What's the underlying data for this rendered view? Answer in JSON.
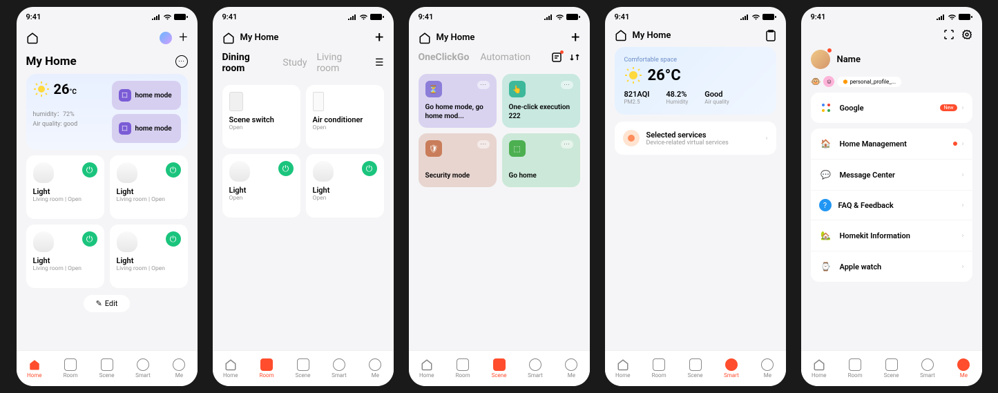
{
  "status": {
    "time": "9:41"
  },
  "tabs": {
    "home": "Home",
    "room": "Room",
    "scene": "Scene",
    "smart": "Smart",
    "me": "Me"
  },
  "s1": {
    "header_home": "My Home",
    "temp": "26",
    "temp_unit": "°C",
    "humidity_label": "humidity：",
    "humidity_val": "72%",
    "aq_label": "Air quality:",
    "aq_val": "good",
    "mode1": "home mode",
    "mode2": "home mode",
    "devices": [
      {
        "name": "Light",
        "sub": "Living room | Open"
      },
      {
        "name": "Light",
        "sub": "Living room | Open"
      },
      {
        "name": "Light",
        "sub": "Living room | Open"
      },
      {
        "name": "Light",
        "sub": "Living room | Open"
      }
    ],
    "edit": "Edit"
  },
  "s2": {
    "header_home": "My Home",
    "rooms": [
      "Dining room",
      "Study",
      "Living room"
    ],
    "devices": [
      {
        "name": "Scene switch",
        "sub": "Open",
        "type": "switch"
      },
      {
        "name": "Air conditioner",
        "sub": "Open",
        "type": "ac"
      },
      {
        "name": "Light",
        "sub": "Open",
        "type": "light"
      },
      {
        "name": "Light",
        "sub": "Open",
        "type": "light"
      }
    ]
  },
  "s3": {
    "header_home": "My Home",
    "tabs": [
      "OneClickGo",
      "Automation"
    ],
    "scenes": [
      {
        "title": "Go home mode, go home mod...",
        "color": "purple"
      },
      {
        "title": "One-click execution 222",
        "color": "teal"
      },
      {
        "title": "Security mode",
        "color": "pink"
      },
      {
        "title": "Go home",
        "color": "green"
      }
    ]
  },
  "s4": {
    "header_home": "My Home",
    "comfort": "Comfortable space",
    "temp": "26°C",
    "metrics": [
      {
        "v": "821AQI",
        "l": "PM2.5"
      },
      {
        "v": "48.2%",
        "l": "Humidity"
      },
      {
        "v": "Good",
        "l": "Air quality"
      }
    ],
    "service_title": "Selected services",
    "service_sub": "Device-related virtual services"
  },
  "s5": {
    "name": "Name",
    "profile_chip": "personal_profile_...",
    "google": "Google",
    "new": "New",
    "menu": [
      {
        "label": "Home Management",
        "ico": "home",
        "color": "#ff6b4a",
        "dot": true
      },
      {
        "label": "Message Center",
        "ico": "msg",
        "color": "#4caf50"
      },
      {
        "label": "FAQ & Feedback",
        "ico": "faq",
        "color": "#2196f3"
      },
      {
        "label": "Homekit Information",
        "ico": "hk",
        "color": "#ff9800"
      },
      {
        "label": "Apple watch",
        "ico": "watch",
        "color": "#2196f3"
      }
    ]
  }
}
